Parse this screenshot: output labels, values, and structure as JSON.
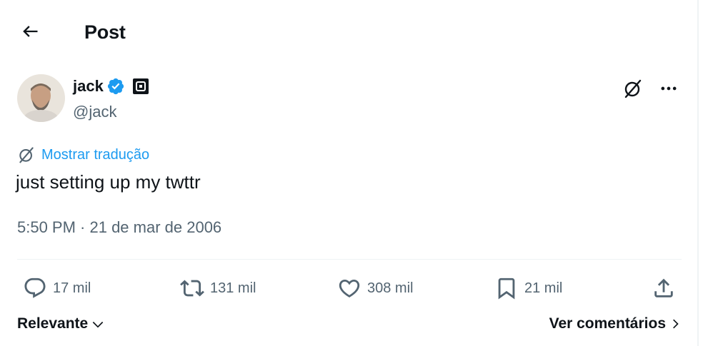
{
  "header": {
    "title": "Post"
  },
  "author": {
    "name": "jack",
    "handle": "@jack"
  },
  "tweet": {
    "translate_label": "Mostrar tradução",
    "text": "just setting up my twttr",
    "timestamp": "5:50 PM · 21 de mar de 2006"
  },
  "actions": {
    "replies": "17 mil",
    "reposts": "131 mil",
    "likes": "308 mil",
    "bookmarks": "21 mil"
  },
  "footer": {
    "sort_label": "Relevante",
    "view_comments_label": "Ver comentários"
  },
  "colors": {
    "accent": "#1d9bf0",
    "secondary_text": "#536471",
    "text": "#0f1419",
    "verified": "#1d9bf0"
  },
  "icons": [
    "back-arrow-icon",
    "verified-icon",
    "affiliate-badge-icon",
    "grok-icon",
    "more-icon",
    "reply-icon",
    "repost-icon",
    "like-icon",
    "bookmark-icon",
    "share-icon",
    "chevron-down-icon",
    "chevron-right-icon"
  ]
}
